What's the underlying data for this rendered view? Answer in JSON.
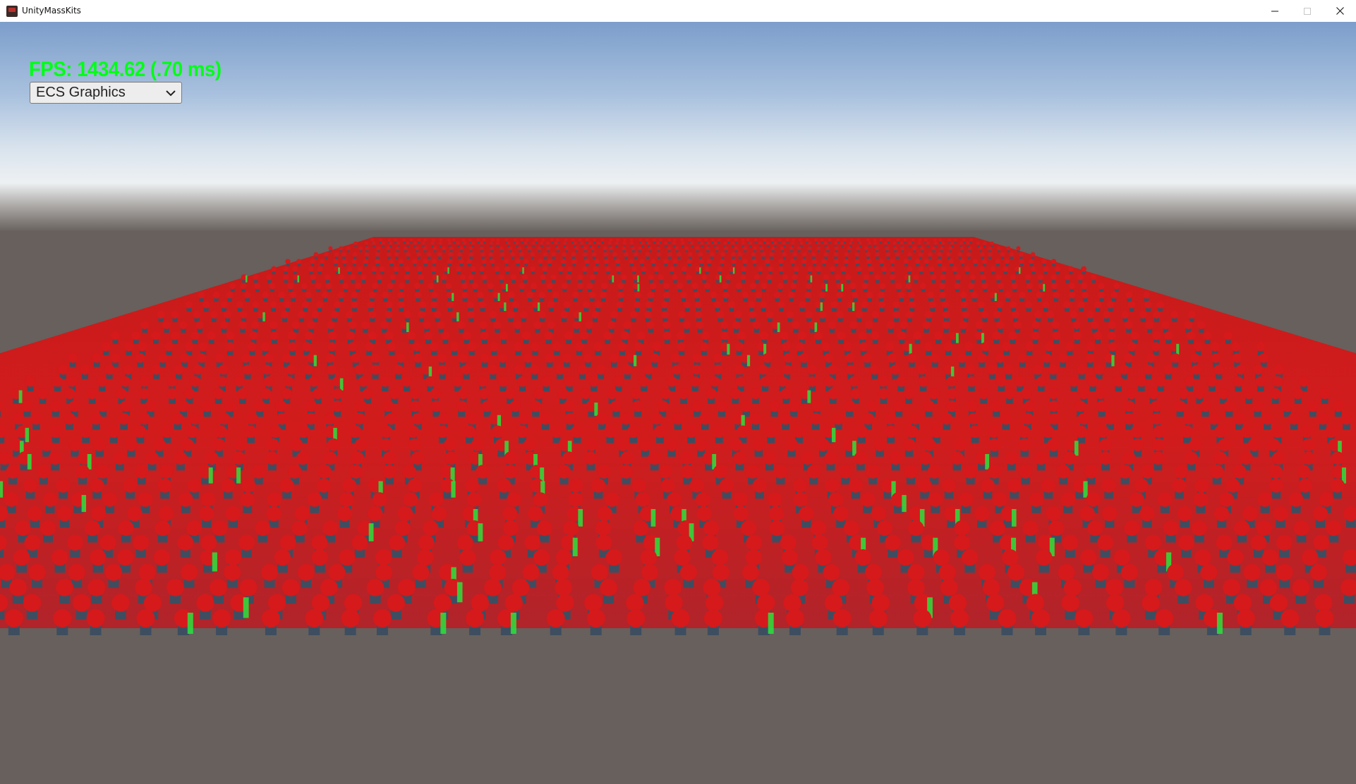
{
  "window": {
    "title": "UnityMassKits",
    "app_icon": "unity-player-icon",
    "controls": [
      "minimize-icon",
      "maximize-icon",
      "close-icon"
    ]
  },
  "hud": {
    "fps_text": "FPS: 1434.62 (.70 ms)",
    "fps_color": "#00ff16"
  },
  "render_mode_dropdown": {
    "selected": "ECS Graphics",
    "icon": "chevron-down-icon"
  },
  "scene": {
    "sky_top_color": "#7fa2cf",
    "sky_horizon_color": "#dfe6ec",
    "ground_color": "#67605c",
    "unit_hair_color": "#d6191b",
    "unit_armor_color": "#3e4e60",
    "effect_color": "#29e33d"
  }
}
